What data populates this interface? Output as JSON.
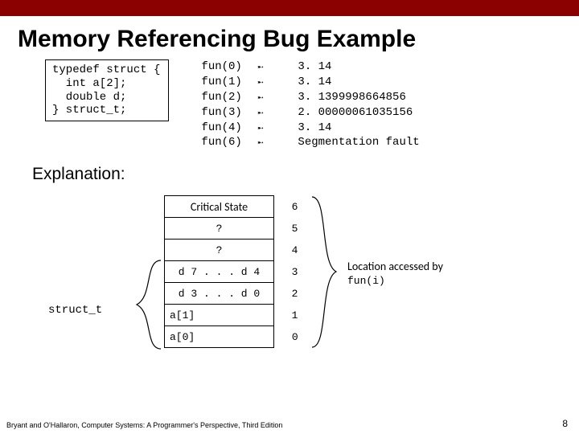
{
  "title": "Memory Referencing Bug Example",
  "code": "typedef struct {\n  int a[2];\n  double d;\n} struct_t;",
  "outputs": [
    {
      "call": "fun(0)",
      "arrow": "➸",
      "val": "3. 14"
    },
    {
      "call": "fun(1)",
      "arrow": "➸",
      "val": "3. 14"
    },
    {
      "call": "fun(2)",
      "arrow": "➸",
      "val": "3. 1399998664856"
    },
    {
      "call": "fun(3)",
      "arrow": "➸",
      "val": "2. 00000061035156"
    },
    {
      "call": "fun(4)",
      "arrow": "➸",
      "val": "3. 14"
    },
    {
      "call": "fun(6)",
      "arrow": "➸",
      "val": "Segmentation fault"
    }
  ],
  "explanation_label": "Explanation:",
  "memory_rows": [
    {
      "label": "Critical State",
      "idx": "6",
      "critical": true
    },
    {
      "label": "?",
      "idx": "5"
    },
    {
      "label": "?",
      "idx": "4"
    },
    {
      "label": "d 7 . . . d 4",
      "idx": "3"
    },
    {
      "label": "d 3 . . . d 0",
      "idx": "2"
    },
    {
      "label": "a[1]",
      "idx": "1"
    },
    {
      "label": "a[0]",
      "idx": "0"
    }
  ],
  "struct_label": "struct_t",
  "right_note_line1": "Location accessed by",
  "right_note_line2": "fun(i)",
  "footer": "Bryant and O'Hallaron, Computer Systems: A Programmer's Perspective, Third Edition",
  "page": "8"
}
